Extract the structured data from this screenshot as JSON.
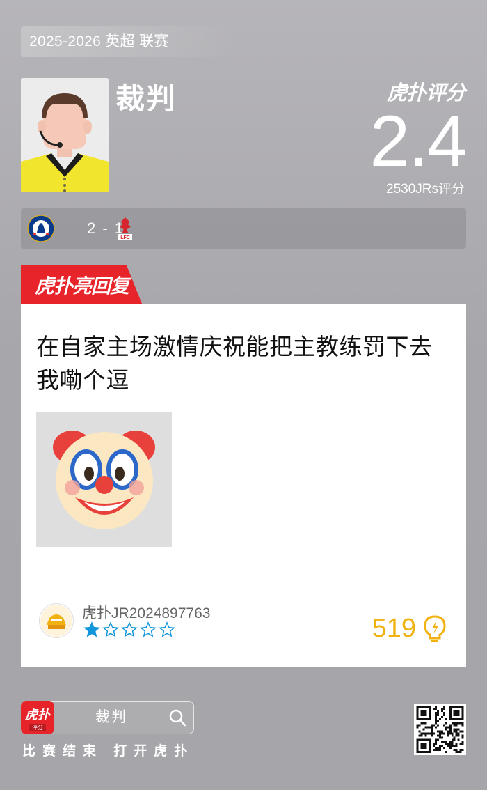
{
  "header": {
    "league": "2025-2026 英超 联赛",
    "role": "裁判",
    "brand": "虎扑评分",
    "score": "2.4",
    "votes": "2530JRs评分"
  },
  "match": {
    "score": "2 - 1",
    "home_icon": "chelsea-crest-icon",
    "away_icon": "liverpool-crest-icon"
  },
  "highlight": {
    "tag": "虎扑亮回复",
    "comment": "在自家主场激情庆祝能把主教练罚下去 我嘞个逗",
    "emoji": "clown-face-icon",
    "user": "虎扑JR2024897763",
    "rating": 1,
    "rating_max": 5,
    "likes": "519"
  },
  "footer": {
    "app_icon_main": "虎扑",
    "app_icon_sub": "评分",
    "search_text": "裁判",
    "caption": "比赛结束 打开虎扑"
  },
  "colors": {
    "accent_red": "#e8242b",
    "likes_gold": "#f1b20f",
    "star_blue": "#1296db"
  }
}
